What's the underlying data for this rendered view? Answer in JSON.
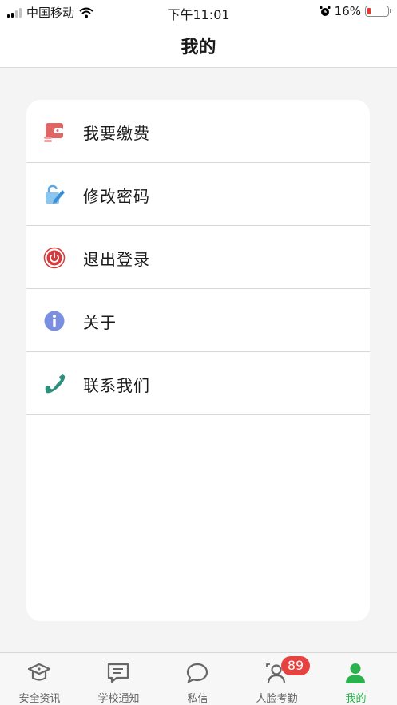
{
  "status_bar": {
    "carrier": "中国移动",
    "time": "下午11:01",
    "battery_text": "16%",
    "battery_level": 0.16,
    "icons": [
      "signal-icon",
      "wifi-icon",
      "alarm-icon",
      "battery-icon"
    ]
  },
  "header": {
    "title": "我的"
  },
  "menu": {
    "items": [
      {
        "label": "我要缴费",
        "icon": "wallet-icon",
        "color": "#e06666"
      },
      {
        "label": "修改密码",
        "icon": "edit-lock-icon",
        "color": "#5aa9e6"
      },
      {
        "label": "退出登录",
        "icon": "power-icon",
        "color": "#d93a3a"
      },
      {
        "label": "关于",
        "icon": "info-icon",
        "color": "#7b8fe0"
      },
      {
        "label": "联系我们",
        "icon": "phone-icon",
        "color": "#2f8f7f"
      }
    ]
  },
  "tab_bar": {
    "active_color": "#2bb24c",
    "inactive_color": "#666666",
    "tabs": [
      {
        "label": "安全资讯",
        "icon": "graduation-cap-icon"
      },
      {
        "label": "学校通知",
        "icon": "message-square-icon"
      },
      {
        "label": "私信",
        "icon": "chat-bubble-icon"
      },
      {
        "label": "人脸考勤",
        "icon": "face-scan-icon",
        "badge": "89"
      },
      {
        "label": "我的",
        "icon": "user-icon",
        "active": true
      }
    ]
  }
}
